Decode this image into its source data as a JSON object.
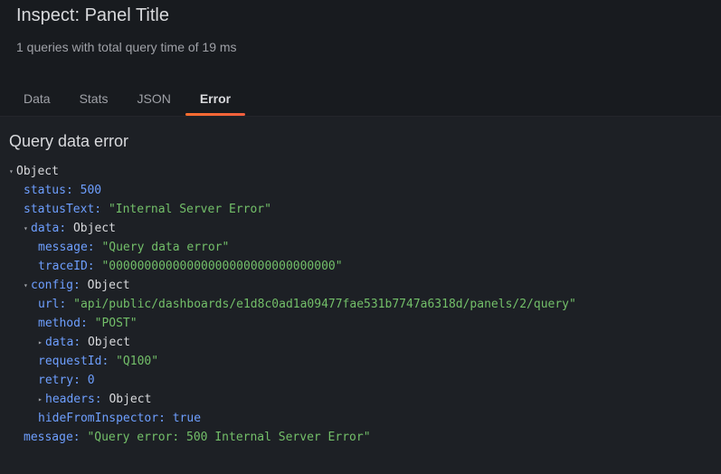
{
  "header": {
    "title": "Inspect: Panel Title",
    "subtitle": "1 queries with total query time of 19 ms"
  },
  "tabs": [
    {
      "label": "Data",
      "active": false
    },
    {
      "label": "Stats",
      "active": false
    },
    {
      "label": "JSON",
      "active": false
    },
    {
      "label": "Error",
      "active": true
    }
  ],
  "error": {
    "section_title": "Query data error",
    "root_label": "Object",
    "status": {
      "key": "status",
      "value": "500"
    },
    "statusText": {
      "key": "statusText",
      "value": "\"Internal Server Error\""
    },
    "data": {
      "key": "data",
      "value": "Object",
      "message": {
        "key": "message",
        "value": "\"Query data error\""
      },
      "traceID": {
        "key": "traceID",
        "value": "\"00000000000000000000000000000000\""
      }
    },
    "config": {
      "key": "config",
      "value": "Object",
      "url": {
        "key": "url",
        "value": "\"api/public/dashboards/e1d8c0ad1a09477fae531b7747a6318d/panels/2/query\""
      },
      "method": {
        "key": "method",
        "value": "\"POST\""
      },
      "data": {
        "key": "data",
        "value": "Object"
      },
      "requestId": {
        "key": "requestId",
        "value": "\"Q100\""
      },
      "retry": {
        "key": "retry",
        "value": "0"
      },
      "headers": {
        "key": "headers",
        "value": "Object"
      },
      "hideFromInspector": {
        "key": "hideFromInspector",
        "value": "true"
      }
    },
    "message": {
      "key": "message",
      "value": "\"Query error: 500 Internal Server Error\""
    }
  },
  "colors": {
    "background": "#181b1f",
    "panel": "#1d2025",
    "key": "#6e9fff",
    "string": "#73bf69",
    "active_tab_underline": "#ff6e2f"
  },
  "icons": {
    "expanded": "caret-down-icon",
    "collapsed": "caret-right-icon"
  }
}
